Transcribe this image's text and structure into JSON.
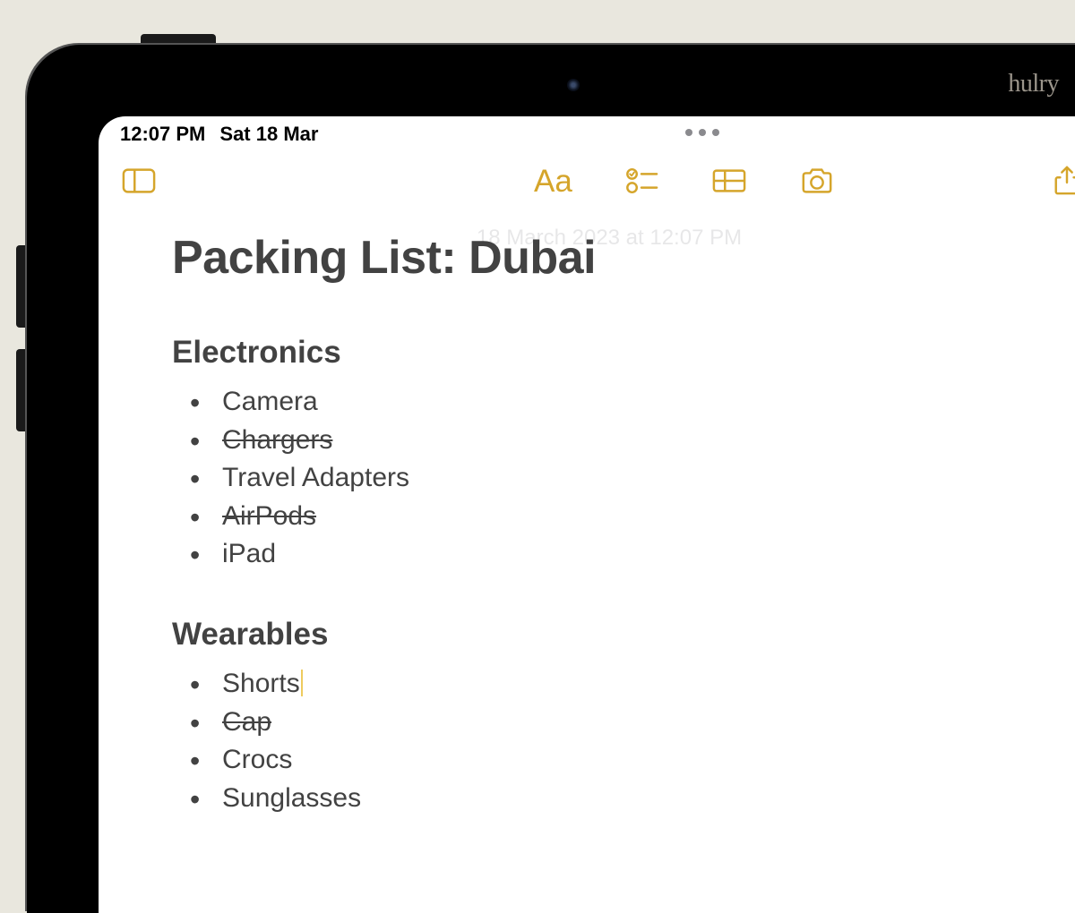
{
  "watermark": "hulry",
  "status": {
    "time": "12:07 PM",
    "date": "Sat 18 Mar"
  },
  "note": {
    "timestamp": "18 March 2023 at 12:07 PM",
    "title": "Packing List: Dubai",
    "sections": [
      {
        "heading": "Electronics",
        "items": [
          {
            "text": "Camera",
            "done": false
          },
          {
            "text": "Chargers",
            "done": true
          },
          {
            "text": "Travel Adapters",
            "done": false
          },
          {
            "text": "AirPods",
            "done": true
          },
          {
            "text": "iPad",
            "done": false
          }
        ]
      },
      {
        "heading": "Wearables",
        "items": [
          {
            "text": "Shorts",
            "done": false,
            "cursor": true
          },
          {
            "text": "Cap",
            "done": true
          },
          {
            "text": "Crocs",
            "done": false
          },
          {
            "text": "Sunglasses",
            "done": false
          }
        ]
      }
    ]
  },
  "toolbar": {
    "format_label": "Aa"
  },
  "colors": {
    "accent": "#d5a52b"
  }
}
